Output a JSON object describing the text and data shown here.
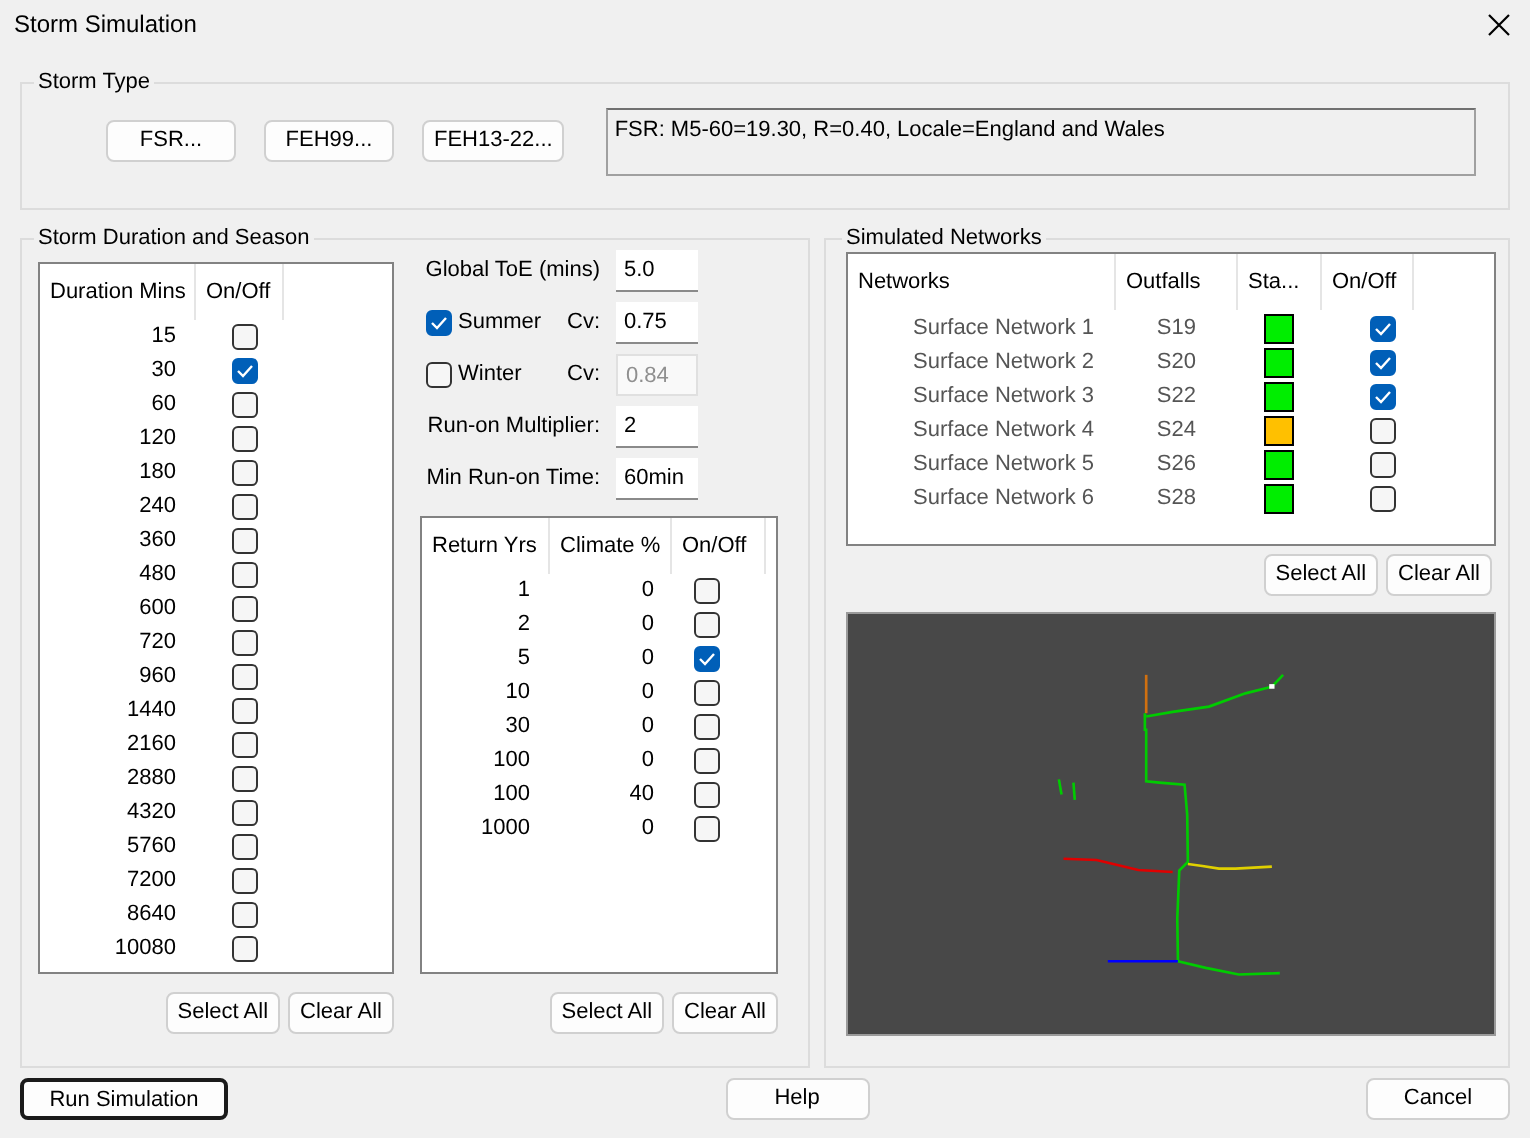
{
  "window": {
    "title": "Storm Simulation"
  },
  "storm_type": {
    "title": "Storm Type",
    "buttons": [
      "FSR...",
      "FEH99...",
      "FEH13-22..."
    ],
    "summary": "FSR: M5-60=19.30, R=0.40, Locale=England and Wales"
  },
  "duration": {
    "title": "Storm Duration and Season",
    "columns": [
      "Duration Mins",
      "On/Off"
    ],
    "rows": [
      {
        "value": "15",
        "checked": false
      },
      {
        "value": "30",
        "checked": true
      },
      {
        "value": "60",
        "checked": false
      },
      {
        "value": "120",
        "checked": false
      },
      {
        "value": "180",
        "checked": false
      },
      {
        "value": "240",
        "checked": false
      },
      {
        "value": "360",
        "checked": false
      },
      {
        "value": "480",
        "checked": false
      },
      {
        "value": "600",
        "checked": false
      },
      {
        "value": "720",
        "checked": false
      },
      {
        "value": "960",
        "checked": false
      },
      {
        "value": "1440",
        "checked": false
      },
      {
        "value": "2160",
        "checked": false
      },
      {
        "value": "2880",
        "checked": false
      },
      {
        "value": "4320",
        "checked": false
      },
      {
        "value": "5760",
        "checked": false
      },
      {
        "value": "7200",
        "checked": false
      },
      {
        "value": "8640",
        "checked": false
      },
      {
        "value": "10080",
        "checked": false
      }
    ],
    "buttons": [
      "Select All",
      "Clear All"
    ]
  },
  "season": {
    "toe_label": "Global ToE (mins)",
    "toe_value": "5.0",
    "seasons": [
      {
        "label": "Summer",
        "checked": true,
        "cv_label": "Cv:",
        "cv": "0.75",
        "disabled": false
      },
      {
        "label": "Winter",
        "checked": false,
        "cv_label": "Cv:",
        "cv": "0.84",
        "disabled": true
      }
    ],
    "multiplier_label": "Run-on Multiplier:",
    "multiplier": "2",
    "runon_label": "Min Run-on Time:",
    "runon": "60min"
  },
  "return_periods": {
    "columns": [
      "Return Yrs",
      "Climate %",
      "On/Off"
    ],
    "rows": [
      {
        "years": "1",
        "climate": "0",
        "checked": false
      },
      {
        "years": "2",
        "climate": "0",
        "checked": false
      },
      {
        "years": "5",
        "climate": "0",
        "checked": true
      },
      {
        "years": "10",
        "climate": "0",
        "checked": false
      },
      {
        "years": "30",
        "climate": "0",
        "checked": false
      },
      {
        "years": "100",
        "climate": "0",
        "checked": false
      },
      {
        "years": "100",
        "climate": "40",
        "checked": false
      },
      {
        "years": "1000",
        "climate": "0",
        "checked": false
      }
    ],
    "buttons": [
      "Select All",
      "Clear All"
    ]
  },
  "networks": {
    "title": "Simulated Networks",
    "columns": [
      "Networks",
      "Outfalls",
      "Sta...",
      "On/Off"
    ],
    "rows": [
      {
        "name": "Surface Network 1",
        "outfall": "S19",
        "color": "#00ee00",
        "checked": true
      },
      {
        "name": "Surface Network 2",
        "outfall": "S20",
        "color": "#00ee00",
        "checked": true
      },
      {
        "name": "Surface Network 3",
        "outfall": "S22",
        "color": "#00ee00",
        "checked": true
      },
      {
        "name": "Surface Network 4",
        "outfall": "S24",
        "color": "#ffc000",
        "checked": false
      },
      {
        "name": "Surface Network 5",
        "outfall": "S26",
        "color": "#00ee00",
        "checked": false
      },
      {
        "name": "Surface Network 6",
        "outfall": "S28",
        "color": "#00ee00",
        "checked": false
      }
    ],
    "buttons": [
      "Select All",
      "Clear All"
    ]
  },
  "footer_buttons": [
    {
      "label": "Run Simulation",
      "focused": true
    },
    {
      "label": "Help",
      "focused": false
    },
    {
      "label": "Cancel",
      "focused": false
    }
  ]
}
